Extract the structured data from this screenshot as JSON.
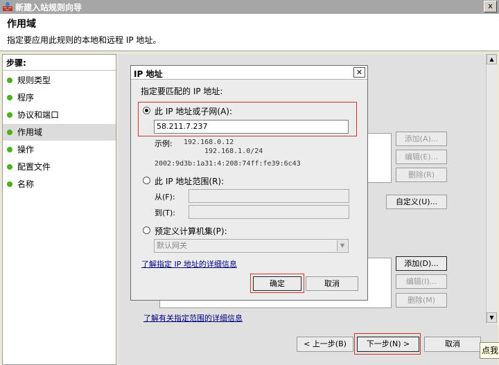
{
  "window": {
    "title": "新建入站规则向导",
    "close": "x"
  },
  "header": {
    "title": "作用域",
    "subtitle": "指定要应用此规则的本地和远程 IP 地址。"
  },
  "steps": {
    "heading": "步骤:",
    "items": [
      {
        "label": "规则类型"
      },
      {
        "label": "程序"
      },
      {
        "label": "协议和端口"
      },
      {
        "label": "作用域"
      },
      {
        "label": "操作"
      },
      {
        "label": "配置文件"
      },
      {
        "label": "名称"
      }
    ],
    "selected_index": 3
  },
  "main": {
    "local": {
      "add": "添加(A)...",
      "edit": "编辑(E)...",
      "delete": "删除(R)"
    },
    "customize": "自定义(U)...",
    "remote": {
      "add": "添加(D)...",
      "edit": "编辑(I)...",
      "delete": "删除(M)"
    },
    "link": "了解有关指定范围的详细信息"
  },
  "nav": {
    "back": "< 上一步(B)",
    "next": "下一步(N) >",
    "cancel": "取消"
  },
  "tooltip": "点我",
  "dialog": {
    "title": "IP 地址",
    "close": "✕",
    "prompt": "指定要匹配的 IP 地址:",
    "opt_subnet": "此 IP 地址或子网(A):",
    "subnet_value": "58.211.7.237",
    "example_label": "示例:",
    "example_1": "192.168.0.12",
    "example_2": "192.168.1.0/24",
    "example_3": "2002:9d3b:1a31:4:208:74ff:fe39:6c43",
    "opt_range": "此 IP 地址范围(R):",
    "from_label": "从(F):",
    "to_label": "到(T):",
    "opt_predef": "预定义计算机集(P):",
    "predef_value": "默认网关",
    "link": "了解指定 IP 地址的详细信息",
    "ok": "确定",
    "cancel": "取消"
  },
  "colors": {
    "accent_highlight": "#d03030",
    "step_dot": "#4ab21f",
    "link": "#000080"
  }
}
